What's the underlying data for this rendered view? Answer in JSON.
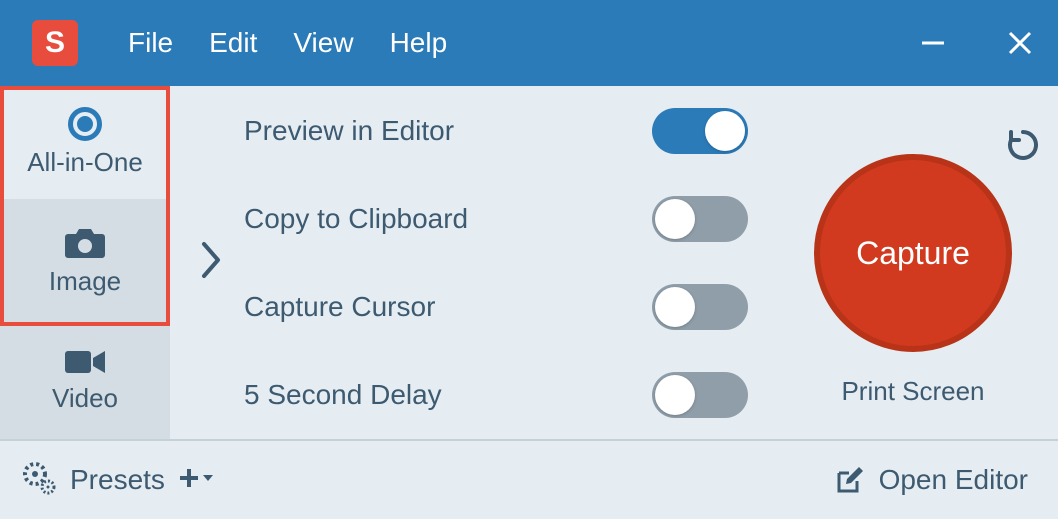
{
  "app": {
    "logo_letter": "S"
  },
  "menu": {
    "file": "File",
    "edit": "Edit",
    "view": "View",
    "help": "Help"
  },
  "sidebar": {
    "tabs": [
      {
        "label": "All-in-One"
      },
      {
        "label": "Image"
      },
      {
        "label": "Video"
      }
    ]
  },
  "settings": {
    "preview": {
      "label": "Preview in Editor",
      "on": true
    },
    "clipboard": {
      "label": "Copy to Clipboard",
      "on": false
    },
    "cursor": {
      "label": "Capture Cursor",
      "on": false
    },
    "delay": {
      "label": "5 Second Delay",
      "on": false
    }
  },
  "capture": {
    "button": "Capture",
    "hotkey": "Print Screen"
  },
  "footer": {
    "presets": "Presets",
    "open_editor": "Open Editor"
  }
}
